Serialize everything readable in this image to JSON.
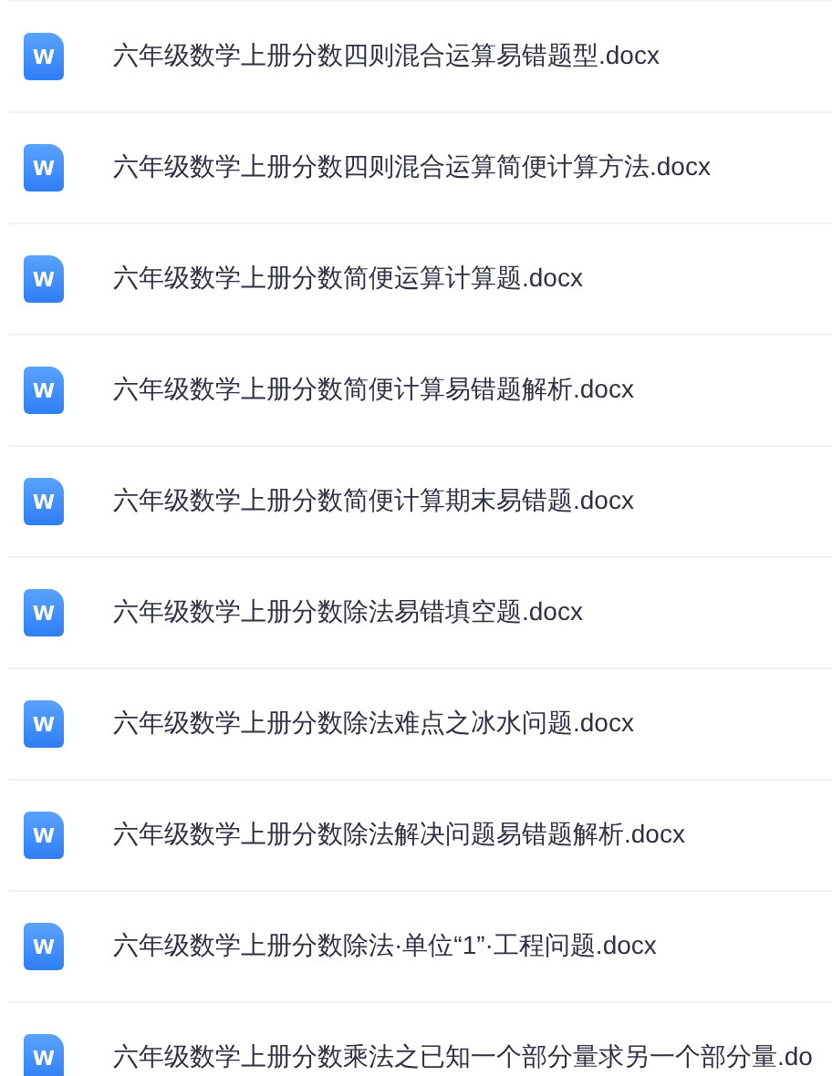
{
  "files": [
    {
      "icon_label": "W",
      "name": "六年级数学上册分数四则混合运算易错题型.docx"
    },
    {
      "icon_label": "W",
      "name": "六年级数学上册分数四则混合运算简便计算方法.docx"
    },
    {
      "icon_label": "W",
      "name": "六年级数学上册分数简便运算计算题.docx"
    },
    {
      "icon_label": "W",
      "name": "六年级数学上册分数简便计算易错题解析.docx"
    },
    {
      "icon_label": "W",
      "name": "六年级数学上册分数简便计算期末易错题.docx"
    },
    {
      "icon_label": "W",
      "name": "六年级数学上册分数除法易错填空题.docx"
    },
    {
      "icon_label": "W",
      "name": "六年级数学上册分数除法难点之冰水问题.docx"
    },
    {
      "icon_label": "W",
      "name": "六年级数学上册分数除法解决问题易错题解析.docx"
    },
    {
      "icon_label": "W",
      "name": "六年级数学上册分数除法·单位“1”·工程问题.docx"
    },
    {
      "icon_label": "W",
      "name": "六年级数学上册分数乘法之已知一个部分量求另一个部分量.do"
    }
  ]
}
